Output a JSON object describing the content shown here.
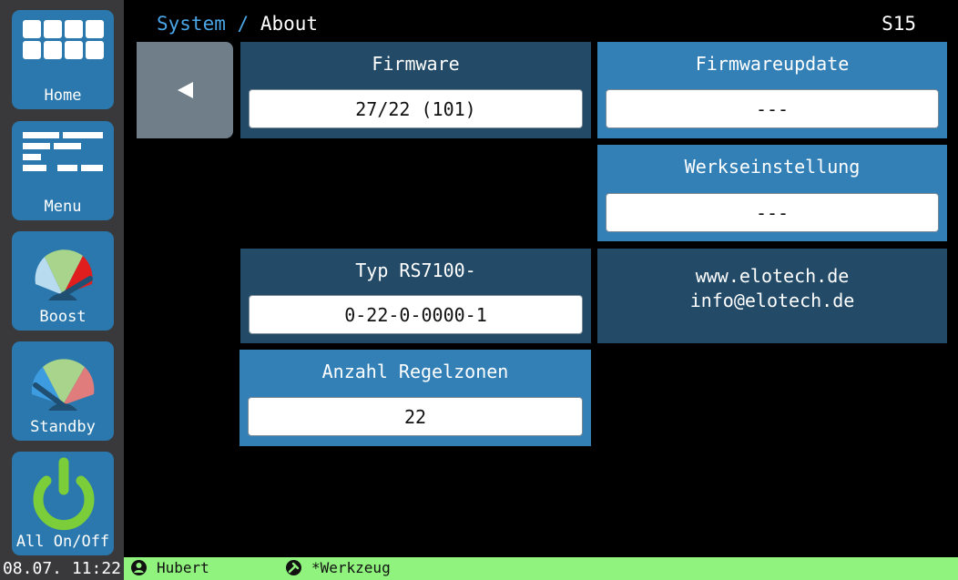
{
  "sidebar": {
    "items": [
      {
        "label": "Home",
        "icon": "grid-icon"
      },
      {
        "label": "Menu",
        "icon": "menu-icon"
      },
      {
        "label": "Boost",
        "icon": "gauge-boost-icon"
      },
      {
        "label": "Standby",
        "icon": "gauge-standby-icon"
      },
      {
        "label": "All On/Off",
        "icon": "power-icon"
      }
    ]
  },
  "header": {
    "breadcrumb": "System",
    "separator": "/",
    "title": "About",
    "screen_id": "S15"
  },
  "firmware": {
    "title": "Firmware",
    "value": "27/22 (101)"
  },
  "firmwareupdate": {
    "title": "Firmwareupdate",
    "value": "---"
  },
  "werkseinstellung": {
    "title": "Werkseinstellung",
    "value": "---"
  },
  "typ": {
    "title": "Typ RS7100-",
    "value": "0-22-0-0000-1"
  },
  "zonen": {
    "title": "Anzahl Regelzonen",
    "value": "22"
  },
  "contact": {
    "web": "www.elotech.de",
    "email": "info@elotech.de"
  },
  "footer": {
    "datetime": "08.07. 11:22",
    "user": "Hubert",
    "tool": "*Werkzeug"
  },
  "colors": {
    "panel_dark": "#234b68",
    "panel_light": "#3380b7",
    "status_bar": "#8ff37d",
    "sidebar_button": "#2a78ad",
    "breadcrumb": "#4aa6e6"
  }
}
